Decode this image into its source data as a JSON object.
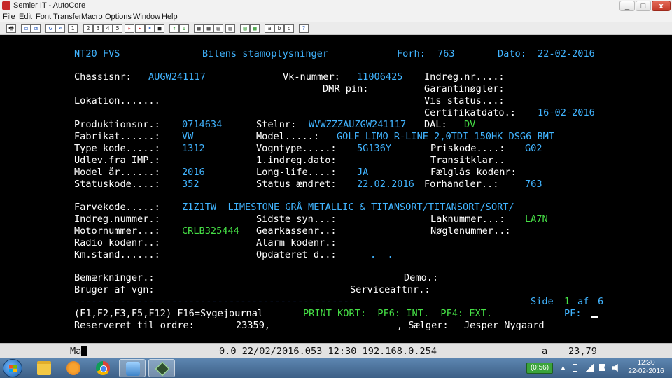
{
  "window": {
    "title": "Semler IT - AutoCore",
    "min_label": "_",
    "max_label": "□",
    "close_label": "x"
  },
  "menu": [
    "File",
    "Edit",
    "Font",
    "Transfer",
    "Macro",
    "Options",
    "Window",
    "Help"
  ],
  "toolbar": {
    "icons": [
      "🖶",
      "⧉",
      "⧉",
      "↻",
      "↶",
      "1",
      "2",
      "3",
      "4",
      "5",
      "▸",
      "▸",
      "⏸",
      "■",
      "↑",
      "↓",
      "▦",
      "▦",
      "▤",
      "▥",
      "▤",
      "▦",
      "a",
      "b",
      "c",
      "?"
    ]
  },
  "screen": {
    "header": {
      "code": "NT20 FVS",
      "title": "Bilens stamoplysninger",
      "forh_label": "Forh:",
      "forh_value": "763",
      "dato_label": "Dato:",
      "dato_value": "22-02-2016"
    },
    "chassis": {
      "label": "Chassisnr:",
      "value": "AUGW241117"
    },
    "vk": {
      "label": "Vk-nummer:",
      "value": "11006425"
    },
    "indreg_nr": {
      "label": "Indreg.nr....:"
    },
    "dmr": {
      "label": "DMR pin:"
    },
    "garanti": {
      "label": "Garantinøgler:"
    },
    "lokation": {
      "label": "Lokation......."
    },
    "vis_status": {
      "label": "Vis status...:"
    },
    "certifikat": {
      "label": "Certifikatdato.:",
      "value": "16-02-2016"
    },
    "produktion": {
      "label": "Produktionsnr.:",
      "value": "0714634"
    },
    "stelnr": {
      "label": "Stelnr:",
      "value": "WVWZZZAUZGW241117"
    },
    "dal": {
      "label": "DAL:",
      "value": "DV"
    },
    "fabrikat": {
      "label": "Fabrikat......:",
      "value": "VW"
    },
    "model": {
      "label": "Model.....:",
      "value": "GOLF LIMO R-LINE 2,0TDI 150HK DSG6 BMT"
    },
    "type_kode": {
      "label": "Type kode.....:",
      "value": "1312"
    },
    "vogntype": {
      "label": "Vogntype.....:",
      "value": "5G136Y"
    },
    "priskode": {
      "label": "Priskode....:",
      "value": "G02"
    },
    "udlev": {
      "label": "Udlev.fra IMP.:"
    },
    "indreg_dato": {
      "label": "1.indreg.dato:"
    },
    "transit": {
      "label": "Transitklar.."
    },
    "model_aar": {
      "label": "Model år......:",
      "value": "2016"
    },
    "long_life": {
      "label": "Long-life....:",
      "value": "JA"
    },
    "faelg": {
      "label": "Fælglås kodenr:"
    },
    "statuskode": {
      "label": "Statuskode....:",
      "value": "352"
    },
    "status_aendret": {
      "label": "Status ændret:",
      "value": "22.02.2016"
    },
    "forhandler": {
      "label": "Forhandler..:",
      "value": "763"
    },
    "farvekode": {
      "label": "Farvekode.....:",
      "value": "Z1Z1TW  LIMESTONE GRÅ METALLIC & TITANSORT/TITANSORT/SORT/"
    },
    "indreg_nummer": {
      "label": "Indreg.nummer.:"
    },
    "sidste_syn": {
      "label": "Sidste syn...:"
    },
    "laknummer": {
      "label": "Laknummer...:",
      "value": "LA7N"
    },
    "motornummer": {
      "label": "Motornummer...:",
      "value": "CRLB325444"
    },
    "gearkasse": {
      "label": "Gearkassenr..:"
    },
    "noegle": {
      "label": "Nøglenummer..:"
    },
    "radio": {
      "label": "Radio kodenr..:"
    },
    "alarm": {
      "label": "Alarm kodenr.:"
    },
    "km": {
      "label": "Km.stand......:"
    },
    "opdateret": {
      "label": "Opdateret d..:",
      "value": ".  ."
    },
    "bemaerk": {
      "label": "Bemærkninger.:"
    },
    "demo": {
      "label": "Demo.:"
    },
    "bruger": {
      "label": "Bruger af vgn:"
    },
    "service": {
      "label": "Serviceaftnr.:"
    },
    "divider": "-------------------------------------------------",
    "side": {
      "label": "Side",
      "current": "1",
      "of": "af",
      "total": "6"
    },
    "fkeys": "(F1,F2,F3,F5,F12) F16=Sygejournal",
    "print": "PRINT KORT:  PF6: INT.  PF4: EXT.",
    "pf": {
      "label": "PF:",
      "value": ""
    },
    "reserveret": {
      "label": "Reserveret til ordre:",
      "value": "23359,",
      "suffix": ", Sælger:",
      "saelger": "Jesper Nygaard"
    }
  },
  "status": {
    "mode": "Ma",
    "info": "0.0 22/02/2016.053 12:30 192.168.0.254",
    "flag": "a",
    "pos": "23,79"
  },
  "taskbar": {
    "battery": "(0:56)",
    "clock_time": "12:30",
    "clock_date": "22-02-2016"
  }
}
